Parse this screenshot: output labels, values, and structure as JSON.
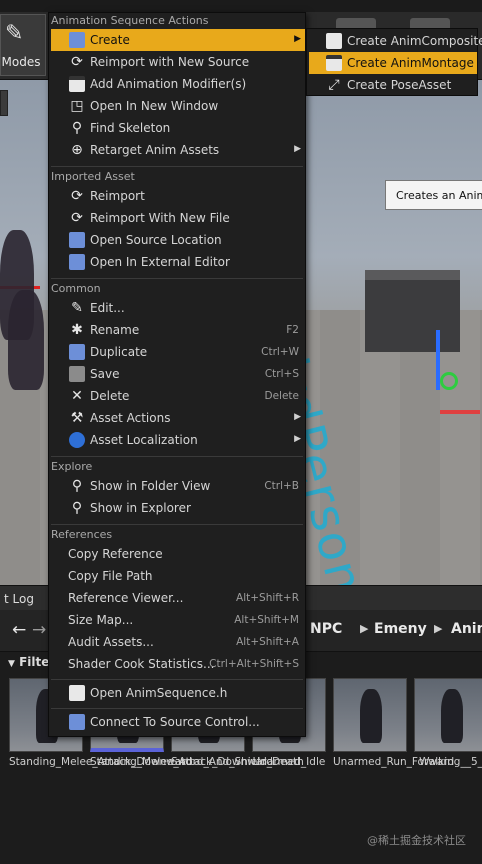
{
  "toolbar": {
    "modes_label": "Modes"
  },
  "viewport": {
    "world_text": "ThirdPerson",
    "tooltip": "Creates an AnimMontage"
  },
  "output_log": {
    "tab_label": "t Log"
  },
  "content_browser": {
    "breadcrumbs": [
      "NPC",
      "Emeny",
      "Anim"
    ],
    "filter_label": "Filte",
    "assets": [
      {
        "name": "Standing_Melee_Attack_Downward",
        "selected": false
      },
      {
        "name": "Standing_Melee_Attack_Downward",
        "selected": true
      },
      {
        "name": "Sword_And_Shield_Death",
        "selected": false
      },
      {
        "name": "Unarmed_Idle",
        "selected": false
      },
      {
        "name": "Unarmed_Run_Forward",
        "selected": false
      },
      {
        "name": "Walking__5_",
        "selected": false
      }
    ],
    "watermark": "@稀土掘金技术社区"
  },
  "menu": {
    "sections": {
      "animation": "Animation Sequence Actions",
      "imported": "Imported Asset",
      "common": "Common",
      "explore": "Explore",
      "references": "References"
    },
    "items": {
      "create": {
        "label": "Create",
        "icon": "create-icon"
      },
      "reimport_new_source": {
        "label": "Reimport with New Source",
        "icon": "reimport-icon"
      },
      "add_modifier": {
        "label": "Add Animation Modifier(s)",
        "icon": "modifier-icon"
      },
      "open_new_window": {
        "label": "Open In New Window",
        "icon": "window-icon"
      },
      "find_skeleton": {
        "label": "Find Skeleton",
        "icon": "search-icon"
      },
      "retarget": {
        "label": "Retarget Anim Assets",
        "icon": "retarget-icon"
      },
      "reimport": {
        "label": "Reimport",
        "icon": "reimport-icon"
      },
      "reimport_new_file": {
        "label": "Reimport With New File",
        "icon": "reimport-icon"
      },
      "open_source_location": {
        "label": "Open Source Location",
        "icon": "folder-icon"
      },
      "open_external_editor": {
        "label": "Open In External Editor",
        "icon": "external-icon"
      },
      "edit": {
        "label": "Edit...",
        "icon": "edit-icon"
      },
      "rename": {
        "label": "Rename",
        "shortcut": "F2",
        "icon": "rename-icon"
      },
      "duplicate": {
        "label": "Duplicate",
        "shortcut": "Ctrl+W",
        "icon": "duplicate-icon"
      },
      "save": {
        "label": "Save",
        "shortcut": "Ctrl+S",
        "icon": "save-icon"
      },
      "delete": {
        "label": "Delete",
        "shortcut": "Delete",
        "icon": "delete-icon"
      },
      "asset_actions": {
        "label": "Asset Actions",
        "icon": "wrench-icon"
      },
      "asset_localization": {
        "label": "Asset Localization",
        "icon": "globe-icon"
      },
      "show_folder_view": {
        "label": "Show in Folder View",
        "shortcut": "Ctrl+B",
        "icon": "search-icon"
      },
      "show_explorer": {
        "label": "Show in Explorer",
        "icon": "search-icon"
      },
      "copy_reference": {
        "label": "Copy Reference"
      },
      "copy_file_path": {
        "label": "Copy File Path"
      },
      "reference_viewer": {
        "label": "Reference Viewer...",
        "shortcut": "Alt+Shift+R"
      },
      "size_map": {
        "label": "Size Map...",
        "shortcut": "Alt+Shift+M"
      },
      "audit_assets": {
        "label": "Audit Assets...",
        "shortcut": "Alt+Shift+A"
      },
      "shader_cook": {
        "label": "Shader Cook Statistics...",
        "shortcut": "Ctrl+Alt+Shift+S"
      },
      "open_anim_sequence_h": {
        "label": "Open AnimSequence.h",
        "icon": "code-icon"
      },
      "connect_source_control": {
        "label": "Connect To Source Control...",
        "icon": "source-control-icon"
      }
    }
  },
  "submenu": {
    "items": [
      {
        "label": "Create AnimComposite",
        "icon": "anim-composite-icon",
        "highlighted": false
      },
      {
        "label": "Create AnimMontage",
        "icon": "anim-montage-icon",
        "highlighted": true
      },
      {
        "label": "Create PoseAsset",
        "icon": "pose-asset-icon",
        "highlighted": false
      }
    ]
  },
  "colors": {
    "highlight": "#e8a91b",
    "menu_bg": "#1f1f1f",
    "world_text": "#2fa8c8"
  }
}
